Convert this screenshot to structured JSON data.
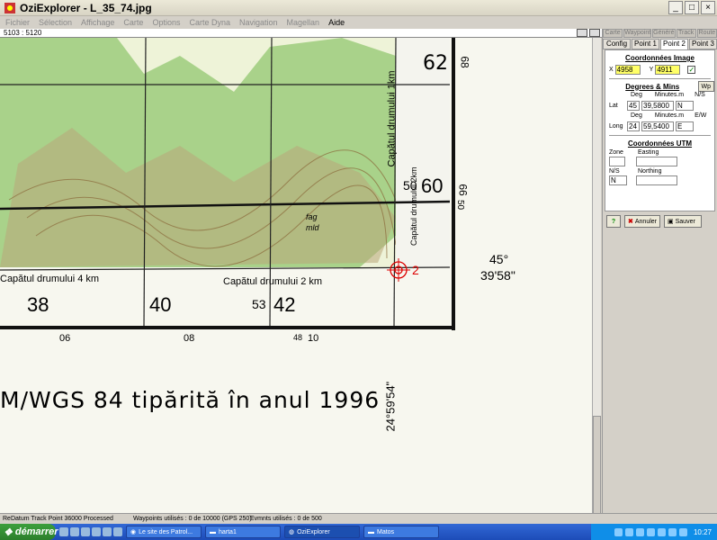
{
  "window": {
    "title": "OziExplorer - L_35_74.jpg"
  },
  "menu": [
    "Fichier",
    "Sélection",
    "Affichage",
    "Carte",
    "Options",
    "Carte Dyna",
    "Navigation",
    "Magellan",
    "Aide"
  ],
  "coordbar": {
    "text": "5103 : 5120"
  },
  "map": {
    "grid_labels": [
      "62",
      "68",
      "50",
      "60",
      "50",
      "66",
      "38",
      "40",
      "53",
      "42",
      "06",
      "08",
      "48",
      "10"
    ],
    "road_labels": [
      "Capătul drumului 1km",
      "Capătul drumului 2km",
      "Capătul drumului 4 km",
      "Capătul drumului 2 km",
      "Capătul drumului 2 km"
    ],
    "forest_label": [
      "fag",
      "mld"
    ],
    "marker_label": "2",
    "lat_lines": [
      "45°",
      "39'58\""
    ],
    "long_label": "24°59'54\"",
    "caption": "M/WGS 84 tipărită în anul 1996"
  },
  "panel": {
    "tabs_top": [
      "Carte",
      "Waypoint",
      "Généré",
      "Track",
      "Route"
    ],
    "tabs": [
      "Config",
      "Point 1",
      "Point 2",
      "Point 3"
    ],
    "image_title": "Coordonnées Image",
    "x_label": "X",
    "x_value": "4958",
    "y_label": "Y",
    "y_value": "4911",
    "dm_title": "Degrees & Mins",
    "wp_label": "Wp",
    "deg": "Deg",
    "min": "Minutes.m",
    "ns": "N/S",
    "ew": "E/W",
    "lat_label": "Lat",
    "lat_deg": "45",
    "lat_min": "39,5800",
    "lat_ns": "N",
    "long_label": "Long",
    "long_deg": "24",
    "long_min": "59,5400",
    "long_ew": "E",
    "utm_title": "Coordonnées UTM",
    "zone": "Zone",
    "easting": "Easting",
    "ns_label": "N/S",
    "ns_value": "N",
    "northing": "Northing",
    "help": "?",
    "cancel": "Annuler",
    "save": "Sauver"
  },
  "status": {
    "left": "ReDatum Track Point 36000 Processed",
    "mid": "Waypoints utilisés : 0 de 10000  (GPS 250)",
    "right": "Evmnts utilisés : 0 de 500"
  },
  "taskbar": {
    "start": "démarrer",
    "tasks": [
      "Le site des Patrol...",
      "harta1",
      "OziExplorer",
      "Matos"
    ],
    "clock": "10:27"
  }
}
